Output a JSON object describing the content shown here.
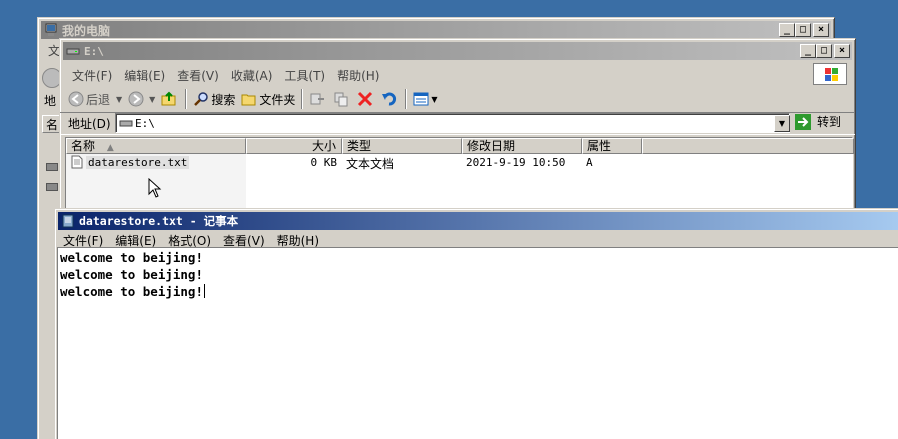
{
  "my_computer": {
    "title": "我的电脑",
    "menu_partial": "文",
    "addr_partial": "地",
    "name_partial": "名"
  },
  "explorer": {
    "title": "E:\\",
    "menu": [
      "文件(F)",
      "编辑(E)",
      "查看(V)",
      "收藏(A)",
      "工具(T)",
      "帮助(H)"
    ],
    "toolbar": {
      "back": "后退",
      "search": "搜索",
      "folders": "文件夹"
    },
    "address_label": "地址(D)",
    "address_value": "E:\\",
    "go_label": "转到",
    "columns": [
      "名称",
      "大小",
      "类型",
      "修改日期",
      "属性"
    ],
    "sort_indicator": "▲",
    "files": [
      {
        "name": "datarestore.txt",
        "size": "0 KB",
        "type": "文本文档",
        "modified": "2021-9-19 10:50",
        "attr": "A"
      }
    ]
  },
  "notepad": {
    "title": "datarestore.txt - 记事本",
    "menu": [
      "文件(F)",
      "编辑(E)",
      "格式(O)",
      "查看(V)",
      "帮助(H)"
    ],
    "lines": [
      "welcome to beijing!",
      "welcome to beijing!",
      "welcome to beijing!"
    ]
  },
  "icons": {
    "window_minimize": "minimize-icon",
    "window_maximize": "maximize-icon",
    "window_close": "close-icon"
  }
}
